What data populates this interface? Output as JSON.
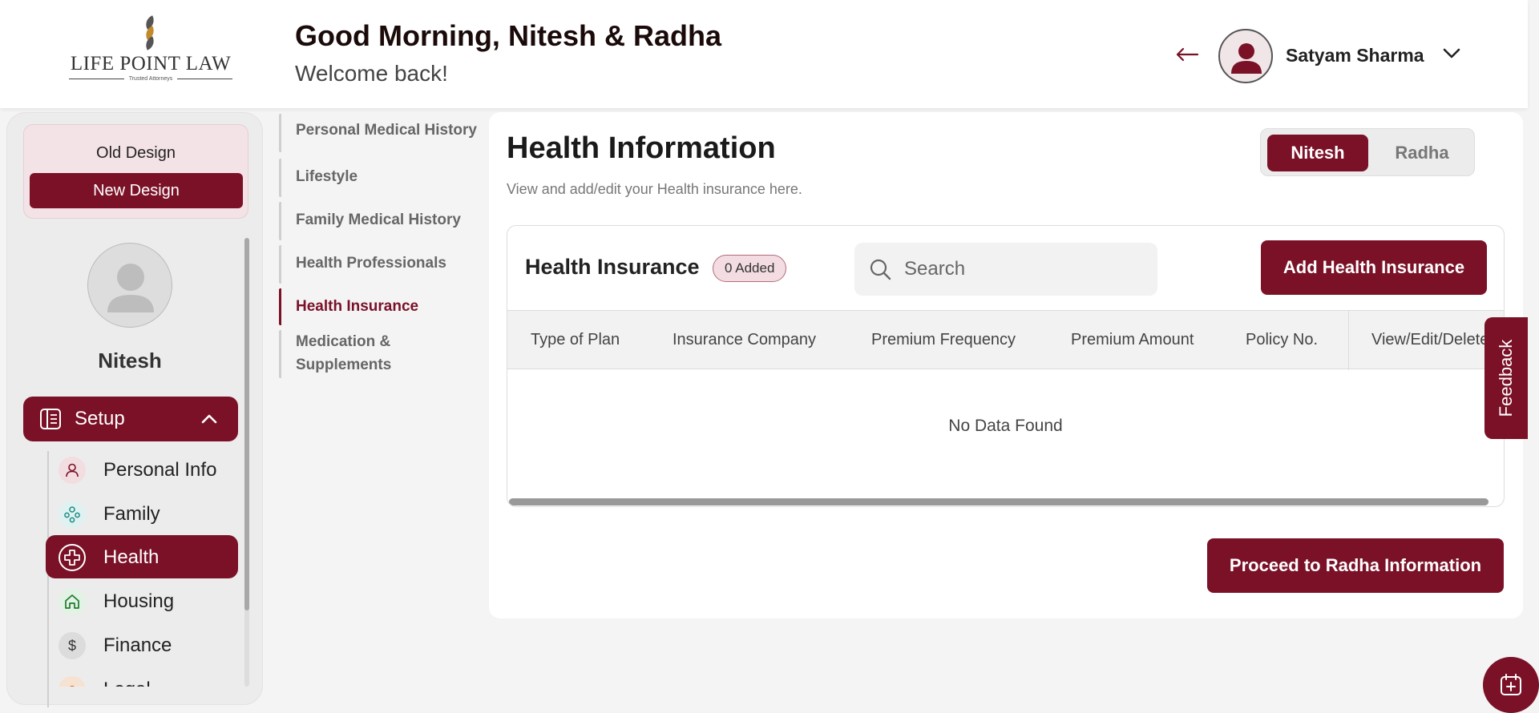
{
  "header": {
    "logo_text": "LIFE POINT LAW",
    "logo_tagline": "Trusted Attorneys",
    "greeting": "Good Morning, Nitesh & Radha",
    "welcome": "Welcome back!",
    "user_name": "Satyam Sharma"
  },
  "sidebar": {
    "old_design": "Old Design",
    "new_design": "New Design",
    "profile_name": "Nitesh",
    "setup_label": "Setup",
    "items": [
      {
        "label": "Personal Info",
        "icon": "person-icon"
      },
      {
        "label": "Family",
        "icon": "family-icon"
      },
      {
        "label": "Health",
        "icon": "health-icon",
        "active": true
      },
      {
        "label": "Housing",
        "icon": "home-icon"
      },
      {
        "label": "Finance",
        "icon": "dollar-icon"
      },
      {
        "label": "Legal",
        "icon": "legal-icon"
      }
    ]
  },
  "subnav": {
    "items": [
      {
        "label": "Personal Medical History"
      },
      {
        "label": "Lifestyle"
      },
      {
        "label": "Family Medical History"
      },
      {
        "label": "Health Professionals"
      },
      {
        "label": "Health Insurance",
        "active": true
      },
      {
        "label": "Medication & Supplements"
      }
    ]
  },
  "main": {
    "title": "Health Information",
    "subtitle": "View and add/edit your Health insurance here.",
    "toggle": {
      "on": "Nitesh",
      "off": "Radha"
    },
    "table": {
      "title": "Health Insurance",
      "badge": "0 Added",
      "search_placeholder": "Search",
      "add_button": "Add Health Insurance",
      "columns": [
        "Type of Plan",
        "Insurance Company",
        "Premium Frequency",
        "Premium Amount",
        "Policy No.",
        "View/Edit/Delete"
      ],
      "empty_text": "No Data Found"
    },
    "proceed_button": "Proceed to Radha Information"
  },
  "feedback_label": "Feedback",
  "colors": {
    "brand": "#7a1127",
    "background": "#f4f4f4"
  }
}
